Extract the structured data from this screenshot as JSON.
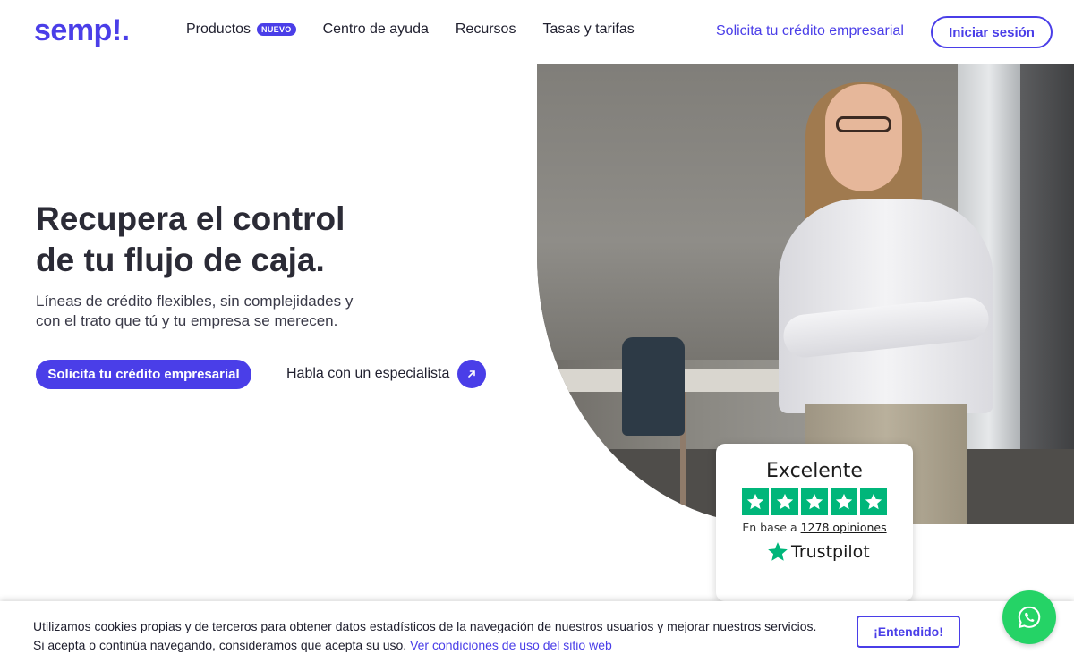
{
  "header": {
    "logo_text": "semp!.",
    "nav": [
      {
        "label": "Productos",
        "badge": "NUEVO"
      },
      {
        "label": "Centro de ayuda"
      },
      {
        "label": "Recursos"
      },
      {
        "label": "Tasas y tarifas"
      }
    ],
    "cta_link": "Solicita tu crédito empresarial",
    "login_label": "Iniciar sesión"
  },
  "hero": {
    "title_line1": "Recupera el control",
    "title_line2": "de tu flujo de caja.",
    "subtitle_line1": "Líneas de crédito flexibles, sin complejidades y",
    "subtitle_line2": "con el trato que tú y tu empresa se merecen.",
    "primary_button": "Solicita tu crédito empresarial",
    "secondary_link": "Habla con un especialista"
  },
  "trustpilot": {
    "rating_label": "Excelente",
    "stars": 5,
    "based_prefix": "En base a",
    "reviews_link": "1278 opiniones",
    "brand": "Trustpilot"
  },
  "cookie": {
    "line1": "Utilizamos cookies propias y de terceros para obtener datos estadísticos de la navegación de nuestros usuarios y mejorar nuestros servicios.",
    "line2": "Si acepta o continúa navegando, consideramos que acepta su uso.",
    "link": "Ver condiciones de uso del sitio web",
    "accept_button": "¡Entendido!"
  },
  "colors": {
    "brand": "#4a3ee8",
    "trustpilot_green": "#00b67a",
    "whatsapp": "#25d366"
  },
  "icons": [
    "arrow-up-right-icon",
    "trustpilot-star-icon",
    "whatsapp-icon"
  ]
}
